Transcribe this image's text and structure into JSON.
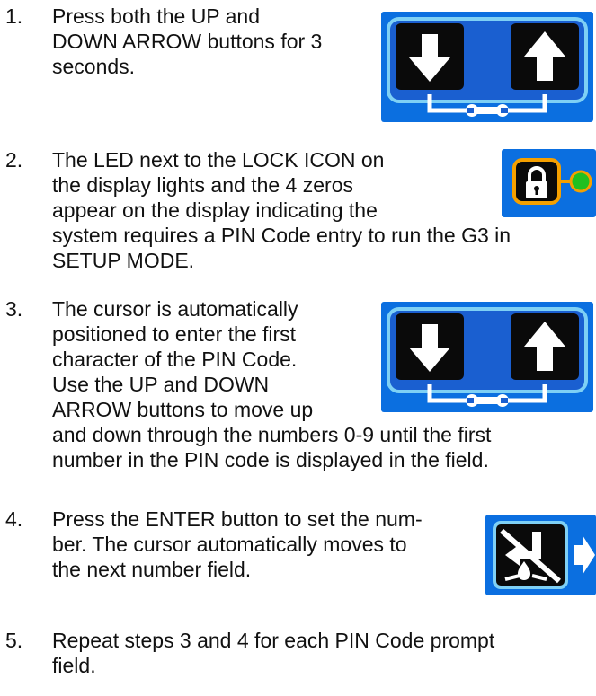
{
  "steps": [
    {
      "num": "1.",
      "lines": [
        "Press both the UP and",
        "DOWN ARROW buttons for 3",
        "seconds."
      ],
      "panel": "up-down-arrow-buttons-icon"
    },
    {
      "num": "2.",
      "lines": [
        "The LED next to the LOCK ICON on",
        "the display lights and the 4 zeros",
        "appear on the display indicating the",
        "system requires a PIN Code entry to run the G3 in",
        "SETUP MODE."
      ],
      "panel": "lock-led-icon"
    },
    {
      "num": "3.",
      "lines": [
        "The cursor is automatically",
        "positioned to enter the first",
        "character of the PIN Code.",
        "Use the UP and DOWN",
        "ARROW buttons to move up",
        "and down through the numbers 0-9 until the first",
        "number in the PIN code is displayed in the field."
      ],
      "panel": "up-down-arrow-buttons-icon"
    },
    {
      "num": "4.",
      "lines": [
        "Press the ENTER button to set the num-",
        "ber. The cursor automatically moves to",
        "the next number field."
      ],
      "panel": "enter-button-icon"
    },
    {
      "num": "5.",
      "lines": [
        "Repeat steps 3 and 4 for each PIN Code prompt",
        "field."
      ]
    }
  ],
  "colors": {
    "panel_blue": "#0b6fe0",
    "panel_inner": "#1a5fd0",
    "border_cyan": "#7ed0f5",
    "button_black": "#0a0a0a",
    "led_green": "#22c020"
  }
}
